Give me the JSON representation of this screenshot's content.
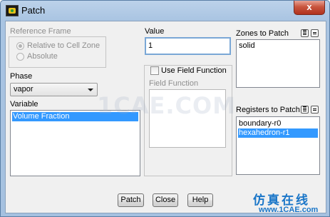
{
  "window": {
    "title": "Patch",
    "close_glyph": "x"
  },
  "reference_frame": {
    "label": "Reference Frame",
    "options": [
      "Relative to Cell Zone",
      "Absolute"
    ],
    "selected": "Relative to Cell Zone"
  },
  "phase": {
    "label": "Phase",
    "value": "vapor"
  },
  "variable": {
    "label": "Variable",
    "items": [
      "Volume Fraction"
    ],
    "selected": "Volume Fraction"
  },
  "value": {
    "label": "Value",
    "text": "1"
  },
  "field_function": {
    "checkbox_label": "Use Field Function",
    "label": "Field Function",
    "checked": false
  },
  "zones_to_patch": {
    "label": "Zones to Patch",
    "items": [
      "solid"
    ]
  },
  "registers_to_patch": {
    "label": "Registers to Patch",
    "items": [
      "boundary-r0",
      "hexahedron-r1"
    ],
    "selected": "hexahedron-r1"
  },
  "buttons": {
    "patch": "Patch",
    "close": "Close",
    "help": "Help"
  },
  "watermark": {
    "text": "1CAE.COM",
    "logo_cn": "仿真在线",
    "logo_url": "www.1CAE.com"
  },
  "colors": {
    "selection": "#3399ff",
    "titlebar": "#a9c4e2",
    "close": "#c8553e",
    "logo": "#1a76c8"
  }
}
